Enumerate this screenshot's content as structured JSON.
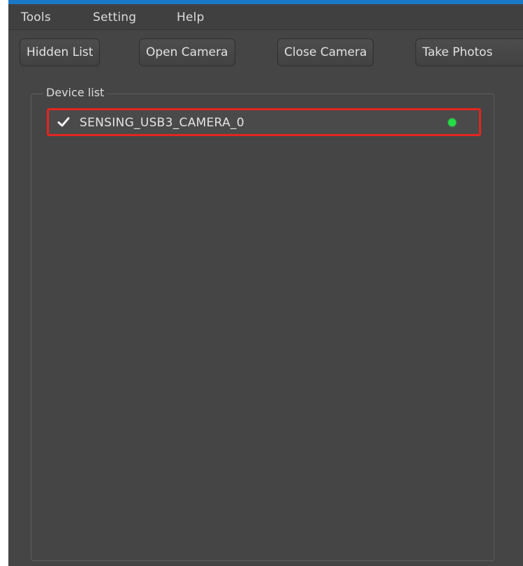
{
  "menubar": {
    "items": [
      {
        "label": "Tools"
      },
      {
        "label": "Setting"
      },
      {
        "label": "Help"
      }
    ]
  },
  "toolbar": {
    "buttons": [
      {
        "label": "Hidden List"
      },
      {
        "label": "Open Camera"
      },
      {
        "label": "Close Camera"
      },
      {
        "label": "Take Photos"
      }
    ]
  },
  "device_panel": {
    "title": "Device list",
    "devices": [
      {
        "name": "SENSING_USB3_CAMERA_0",
        "checked": true,
        "status": "connected",
        "status_color": "#22dd44",
        "highlight_color": "#e3251f"
      }
    ]
  },
  "colors": {
    "window_bg": "#454545",
    "menubar_bg": "#404040",
    "accent_top": "#1b78c9"
  }
}
